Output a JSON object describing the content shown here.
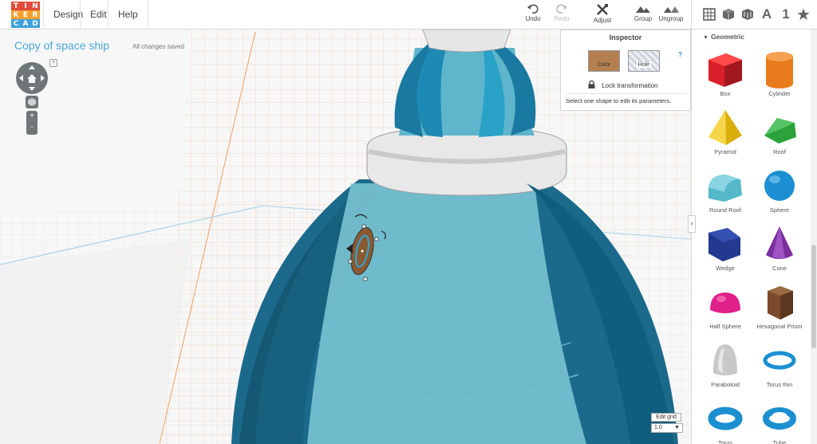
{
  "app": {
    "logo_letters": [
      "T",
      "I",
      "N",
      "K",
      "E",
      "R",
      "C",
      "A",
      "D"
    ],
    "logo_colors": [
      "#e24b39",
      "#e24b39",
      "#e24b39",
      "#f4a02e",
      "#f4a02e",
      "#f4a02e",
      "#3ea1d9",
      "#3ea1d9",
      "#3ea1d9"
    ]
  },
  "menu": {
    "design": "Design",
    "edit": "Edit",
    "help": "Help"
  },
  "toolbar": {
    "undo": "Undo",
    "redo": "Redo",
    "adjust": "Adjust",
    "group": "Group",
    "ungroup": "Ungroup"
  },
  "right_tools": {
    "text_tool": "A",
    "number_tool": "1"
  },
  "document": {
    "title": "Copy of space ship",
    "save_status": "All changes saved",
    "help": "?"
  },
  "inspector": {
    "title": "Inspector",
    "color_label": "Color",
    "hole_label": "Hole",
    "help": "?",
    "lock_label": "Lock transformation",
    "hint": "Select one shape to edit its parameters."
  },
  "shape_panel": {
    "category": "Geometric",
    "shapes": [
      {
        "label": "Box",
        "icon": "box-icon",
        "color": "#d9202a"
      },
      {
        "label": "Cylinder",
        "icon": "cylinder-icon",
        "color": "#e87b1c"
      },
      {
        "label": "Pyramid",
        "icon": "pyramid-icon",
        "color": "#f4c20d"
      },
      {
        "label": "Roof",
        "icon": "roof-icon",
        "color": "#2ca23a"
      },
      {
        "label": "Round Roof",
        "icon": "round-roof-icon",
        "color": "#55b8c9"
      },
      {
        "label": "Sphere",
        "icon": "sphere-icon",
        "color": "#1b8fd0"
      },
      {
        "label": "Wedge",
        "icon": "wedge-icon",
        "color": "#23398f"
      },
      {
        "label": "Cone",
        "icon": "cone-icon",
        "color": "#7b2e9e"
      },
      {
        "label": "Half Sphere",
        "icon": "half-sphere-icon",
        "color": "#e0218a"
      },
      {
        "label": "Hexagonal Prism",
        "icon": "hexagonal-prism-icon",
        "color": "#7a4a2a"
      },
      {
        "label": "Paraboloid",
        "icon": "paraboloid-icon",
        "color": "#c8c8c8"
      },
      {
        "label": "Torus thin",
        "icon": "torus-thin-icon",
        "color": "#1b8fd0"
      },
      {
        "label": "Torus",
        "icon": "torus-icon",
        "color": "#1b8fd0"
      },
      {
        "label": "Tube",
        "icon": "tube-icon",
        "color": "#1b8fd0"
      }
    ]
  },
  "grid": {
    "edit_label": "Edit grid",
    "snap_value": "1.0"
  }
}
